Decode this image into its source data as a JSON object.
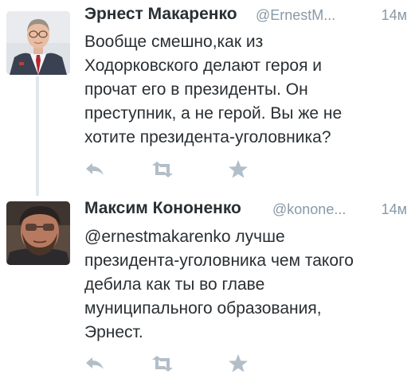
{
  "colors": {
    "name": "#292f33",
    "meta": "#8899a6",
    "action_icon": "#b2bec8",
    "thread_line": "#e1e8ed"
  },
  "tweets": [
    {
      "display_name": "Эрнест Макаренко",
      "username": "@ErnestM...",
      "time": "14м",
      "text_lines": [
        "Вообще смешно,как из",
        "Ходорковского делают героя и",
        "прочат его в президенты. Он",
        "преступник, а не герой. Вы же не",
        "хотите президента-уголовника?"
      ],
      "actions": [
        "reply-icon",
        "retweet-icon",
        "favorite-star-icon"
      ]
    },
    {
      "display_name": "Максим Кононенко",
      "username": "@konone...",
      "time": "14м",
      "text_lines": [
        "@ernestmakarenko лучше",
        "президента-уголовника чем такого",
        "дебила как ты во главе",
        "муниципального образования,",
        "Эрнест."
      ],
      "actions": [
        "reply-icon",
        "retweet-icon",
        "favorite-star-icon"
      ]
    }
  ]
}
